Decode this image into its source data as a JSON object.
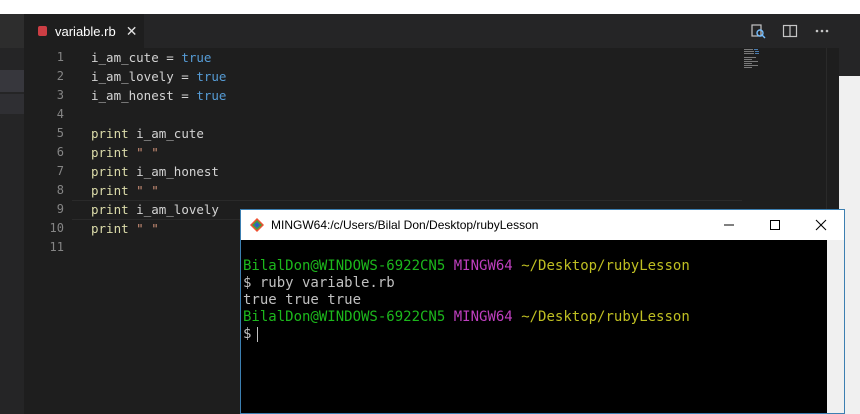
{
  "editor": {
    "tab": {
      "label": "variable.rb",
      "close": "✕"
    },
    "line_numbers": [
      "1",
      "2",
      "3",
      "4",
      "5",
      "6",
      "7",
      "8",
      "9",
      "10",
      "11"
    ],
    "lines": [
      {
        "a": "i_am_cute = ",
        "b": "true"
      },
      {
        "a": "i_am_lovely = ",
        "b": "true"
      },
      {
        "a": "i_am_honest = ",
        "b": "true"
      },
      {
        "a": "",
        "b": ""
      },
      {
        "kw": "print",
        "rest": " i_am_cute"
      },
      {
        "kw": "print",
        "str": " \" \""
      },
      {
        "kw": "print",
        "rest": " i_am_honest"
      },
      {
        "kw": "print",
        "str": " \" \""
      },
      {
        "kw": "print",
        "rest": " i_am_lovely"
      },
      {
        "kw": "print",
        "str": " \" \""
      },
      {
        "a": "",
        "b": ""
      }
    ],
    "colors": {
      "background": "#1e1e1e",
      "keyword_true": "#569cd6",
      "function": "#dcdcaa",
      "string": "#ce9178"
    }
  },
  "terminal": {
    "title": "MINGW64:/c/Users/Bilal Don/Desktop/rubyLesson",
    "prompt_user": "BilalDon@WINDOWS-6922CN5",
    "prompt_env": "MINGW64",
    "prompt_path": "~/Desktop/rubyLesson",
    "command_line": "$ ruby variable.rb",
    "output_line": "true true true",
    "final_prompt": "$",
    "colors": {
      "user": "#1cb81c",
      "env": "#bf3fbf",
      "path": "#bfbf22"
    }
  }
}
